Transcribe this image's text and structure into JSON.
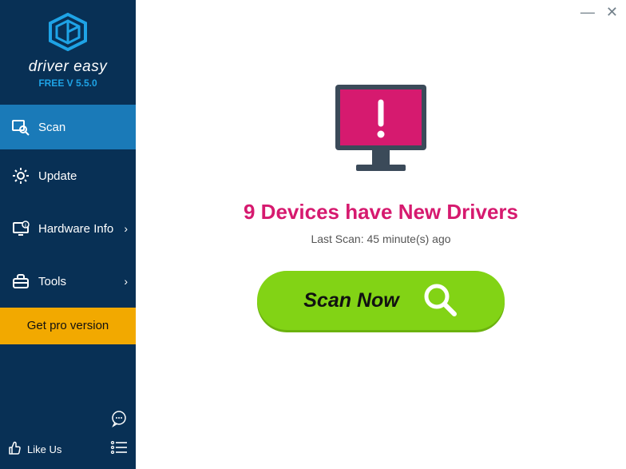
{
  "brand": {
    "name": "driver easy",
    "version": "FREE V 5.5.0"
  },
  "sidebar": {
    "items": [
      {
        "label": "Scan"
      },
      {
        "label": "Update"
      },
      {
        "label": "Hardware Info"
      },
      {
        "label": "Tools"
      }
    ],
    "get_pro": "Get pro version",
    "like_us": "Like Us"
  },
  "main": {
    "headline": "9 Devices have New Drivers",
    "subline": "Last Scan: 45 minute(s) ago",
    "scan_button": "Scan Now"
  },
  "colors": {
    "accent_pink": "#d61a6f",
    "accent_green": "#82d315",
    "accent_orange": "#f2a900",
    "sidebar_bg": "#083055",
    "sidebar_active": "#1a7ab8",
    "logo_blue": "#1ea3e6"
  }
}
